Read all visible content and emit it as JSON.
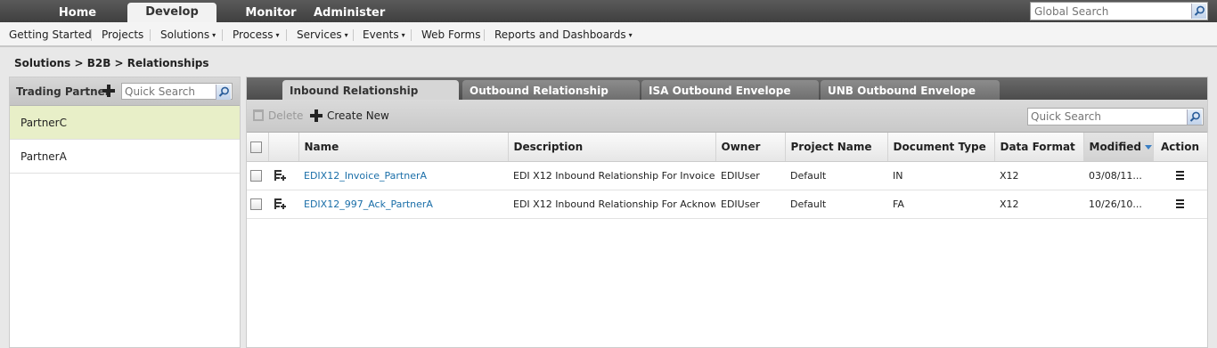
{
  "top_nav": {
    "tabs": [
      "Home",
      "Develop",
      "Monitor",
      "Administer"
    ],
    "active_tab": "Develop",
    "global_search_placeholder": "Global Search"
  },
  "sub_nav": {
    "items": [
      {
        "label": "Getting Started"
      },
      {
        "label": "Projects"
      },
      {
        "label": "Solutions",
        "caret": "▾"
      },
      {
        "label": "Process",
        "caret": "▾"
      },
      {
        "label": "Services",
        "caret": "▾"
      },
      {
        "label": "Events",
        "caret": "▾"
      },
      {
        "label": "Web Forms"
      },
      {
        "label": "Reports and Dashboards",
        "caret": "▾"
      }
    ]
  },
  "breadcrumb": "Solutions > B2B > Relationships",
  "left_panel": {
    "title": "Trading Partner",
    "search_placeholder": "Quick Search",
    "partners": [
      "PartnerC",
      "PartnerA"
    ],
    "selected": "PartnerC"
  },
  "tabs": {
    "items": [
      "Inbound Relationship",
      "Outbound Relationship",
      "ISA Outbound Envelope",
      "UNB Outbound Envelope"
    ],
    "active": "Inbound Relationship"
  },
  "toolbar": {
    "delete_label": "Delete",
    "create_label": "Create New",
    "search_placeholder": "Quick Search"
  },
  "table": {
    "columns": [
      "Name",
      "Description",
      "Owner",
      "Project Name",
      "Document Type",
      "Data Format",
      "Modified",
      "Action"
    ],
    "sorted_column": "Modified",
    "rows": [
      {
        "name": "EDIX12_Invoice_PartnerA",
        "description": "EDI X12 Inbound Relationship For Invoice...",
        "owner": "EDIUser",
        "project": "Default",
        "doc_type": "IN",
        "data_format": "X12",
        "modified": "03/08/11..."
      },
      {
        "name": "EDIX12_997_Ack_PartnerA",
        "description": "EDI X12 Inbound Relationship For Acknow...",
        "owner": "EDIUser",
        "project": "Default",
        "doc_type": "FA",
        "data_format": "X12",
        "modified": "10/26/10..."
      }
    ]
  }
}
